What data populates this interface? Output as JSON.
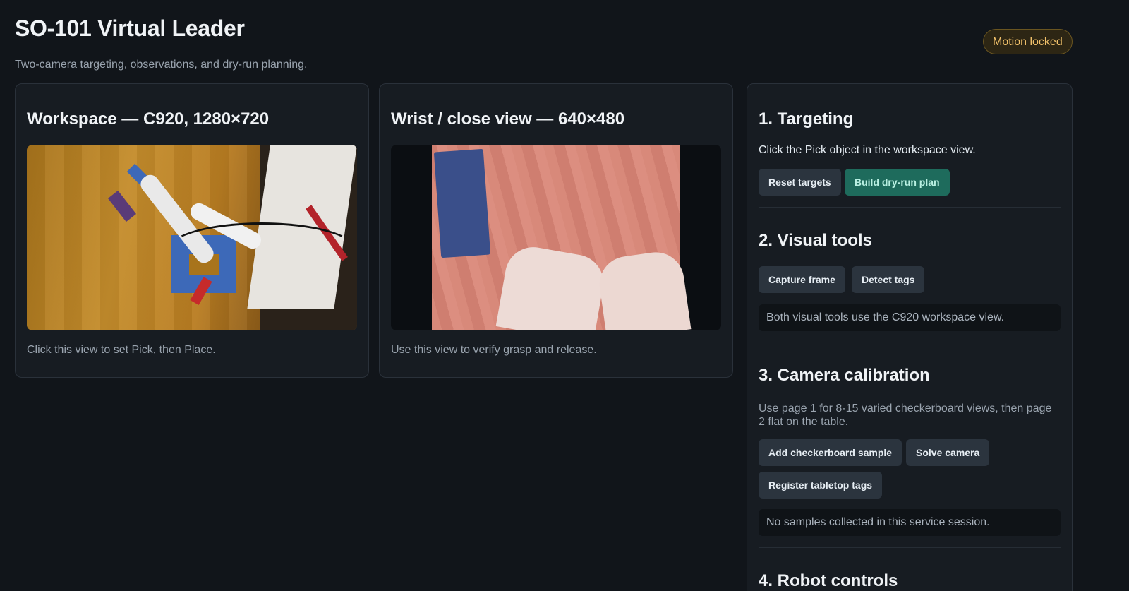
{
  "header": {
    "title": "SO-101 Virtual Leader",
    "subtitle": "Two-camera targeting, observations, and dry-run planning.",
    "status_badge": "Motion locked"
  },
  "cameras": {
    "workspace": {
      "title": "Workspace — C920, 1280×720",
      "caption": "Click this view to set Pick, then Place."
    },
    "wrist": {
      "title": "Wrist / close view — 640×480",
      "caption": "Use this view to verify grasp and release."
    }
  },
  "panel": {
    "targeting": {
      "heading": "1. Targeting",
      "instruction": "Click the Pick object in the workspace view.",
      "reset_label": "Reset targets",
      "build_label": "Build dry-run plan"
    },
    "visual_tools": {
      "heading": "2. Visual tools",
      "capture_label": "Capture frame",
      "detect_label": "Detect tags",
      "status": "Both visual tools use the C920 workspace view."
    },
    "calibration": {
      "heading": "3. Camera calibration",
      "instruction": "Use page 1 for 8-15 varied checkerboard views, then page 2 flat on the table.",
      "add_sample_label": "Add checkerboard sample",
      "solve_label": "Solve camera",
      "register_label": "Register tabletop tags",
      "status": "No samples collected in this service session."
    },
    "robot_controls": {
      "heading": "4. Robot controls"
    }
  },
  "colors": {
    "background": "#11151a",
    "card": "#171c22",
    "accent_button": "#1e6b5c",
    "badge_text": "#f2c26b"
  }
}
